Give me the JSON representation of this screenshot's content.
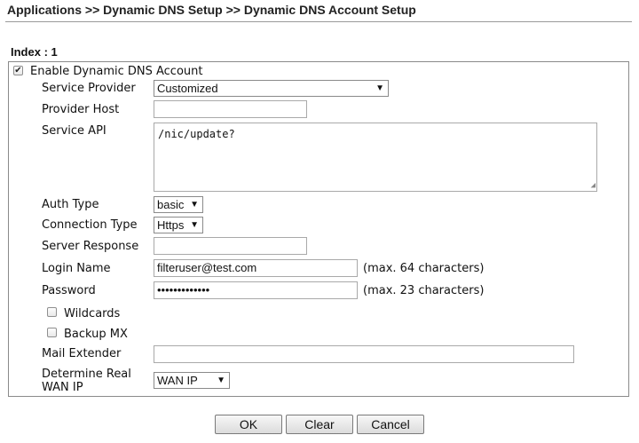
{
  "breadcrumb": "Applications >> Dynamic DNS Setup >> Dynamic DNS Account Setup",
  "index_label": "Index : 1",
  "enable": {
    "label": "Enable Dynamic DNS Account",
    "checked": true
  },
  "service_provider": {
    "label": "Service Provider",
    "value": "Customized"
  },
  "provider_host": {
    "label": "Provider Host",
    "value": ""
  },
  "service_api": {
    "label": "Service API",
    "value": "/nic/update?"
  },
  "auth_type": {
    "label": "Auth Type",
    "value": "basic"
  },
  "connection_type": {
    "label": "Connection Type",
    "value": "Https"
  },
  "server_response": {
    "label": "Server Response",
    "value": ""
  },
  "login_name": {
    "label": "Login Name",
    "value": "filteruser@test.com",
    "hint": "(max. 64 characters)"
  },
  "password": {
    "label": "Password",
    "value": "•••••••••••••",
    "hint": "(max. 23 characters)"
  },
  "wildcards": {
    "label": "Wildcards",
    "checked": false
  },
  "backup_mx": {
    "label": "Backup MX",
    "checked": false
  },
  "mail_extender": {
    "label": "Mail Extender",
    "value": ""
  },
  "determine_wan": {
    "label_line1": "Determine Real",
    "label_line2": "WAN IP",
    "value": "WAN IP"
  },
  "buttons": {
    "ok": "OK",
    "clear": "Clear",
    "cancel": "Cancel"
  },
  "icons": {
    "check": "✔",
    "dropdown": "▼",
    "resize": "◢"
  }
}
